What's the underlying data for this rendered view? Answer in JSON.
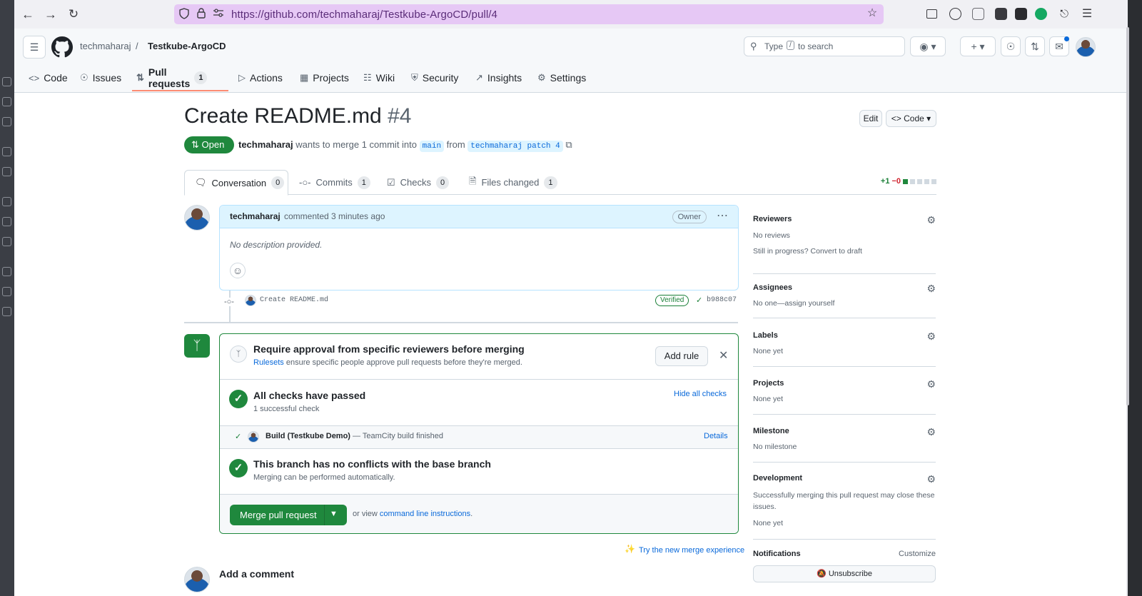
{
  "browser": {
    "url": "https://github.com/techmaharaj/Testkube-ArgoCD/pull/4"
  },
  "header": {
    "owner": "techmaharaj",
    "separator": "/",
    "repo": "Testkube-ArgoCD",
    "search_pre": "Type",
    "search_key": "/",
    "search_post": "to search"
  },
  "repo_nav": {
    "code": "Code",
    "issues": "Issues",
    "pull_requests": "Pull requests",
    "pull_requests_count": "1",
    "actions": "Actions",
    "projects": "Projects",
    "wiki": "Wiki",
    "security": "Security",
    "insights": "Insights",
    "settings": "Settings"
  },
  "pr": {
    "title": "Create README.md",
    "number": "#4",
    "edit_label": "Edit",
    "code_label": "Code",
    "state": "Open",
    "author": "techmaharaj",
    "wants_to_merge": "wants to merge 1 commit into",
    "base_branch": "main",
    "from_label": "from",
    "head_branch": "techmaharaj patch 4"
  },
  "pr_tabs": {
    "conversation": "Conversation",
    "conversation_count": "0",
    "commits": "Commits",
    "commits_count": "1",
    "checks": "Checks",
    "checks_count": "0",
    "files_changed": "Files changed",
    "files_count": "1",
    "additions": "+1",
    "deletions": "−0"
  },
  "comment": {
    "author": "techmaharaj",
    "meta": "commented 3 minutes ago",
    "role_badge": "Owner",
    "body": "No description provided."
  },
  "commit": {
    "message": "Create README.md",
    "verified": "Verified",
    "sha": "b988c07"
  },
  "merge_box": {
    "ruleset_title": "Require approval from specific reviewers before merging",
    "ruleset_link": "Rulesets",
    "ruleset_desc": "ensure specific people approve pull requests before they're merged.",
    "add_rule": "Add rule",
    "checks_title": "All checks have passed",
    "checks_sub": "1 successful check",
    "hide_checks": "Hide all checks",
    "check_name": "Build (Testkube Demo)",
    "check_desc": "— TeamCity build finished",
    "details": "Details",
    "conflicts_title": "This branch has no conflicts with the base branch",
    "conflicts_sub": "Merging can be performed automatically.",
    "merge_button": "Merge pull request",
    "or_view": "or view",
    "cli_link": "command line instructions",
    "cli_end": "."
  },
  "try_new_merge": "Try the new merge experience",
  "add_comment": "Add a comment",
  "sidebar": {
    "reviewers_title": "Reviewers",
    "reviewers_value": "No reviews",
    "in_progress": "Still in progress?",
    "convert_draft": "Convert to draft",
    "assignees_title": "Assignees",
    "assignees_value": "No one—",
    "assign_yourself": "assign yourself",
    "labels_title": "Labels",
    "labels_value": "None yet",
    "projects_title": "Projects",
    "projects_value": "None yet",
    "milestone_title": "Milestone",
    "milestone_value": "No milestone",
    "development_title": "Development",
    "development_desc": "Successfully merging this pull request may close these issues.",
    "development_value": "None yet",
    "notifications_title": "Notifications",
    "customize": "Customize",
    "unsubscribe": "Unsubscribe"
  }
}
